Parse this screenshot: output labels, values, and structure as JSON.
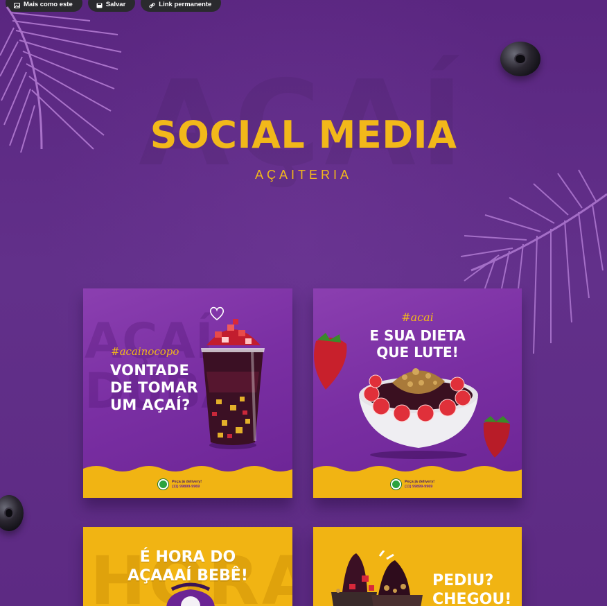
{
  "toolbar": {
    "more_like_this": "Mais como este",
    "save": "Salvar",
    "permalink": "Link permanente"
  },
  "header": {
    "title": "SOCIAL MEDIA",
    "subtitle": "AÇAITERIA"
  },
  "colors": {
    "background": "#5e2a82",
    "accent_yellow": "#f2b81a",
    "card_purple": "#7a2fa3",
    "whatsapp_green": "#2aa33f"
  },
  "cards": [
    {
      "hashtag": "#acainocopo",
      "headline_lines": [
        "VONTADE",
        "DE TOMAR",
        "UM AÇAÍ?"
      ],
      "delivery_label": "Peça já delivery!",
      "phone": "(11) 99899-9969",
      "image": "acai-cup-with-strawberries"
    },
    {
      "hashtag": "#acai",
      "headline_lines": [
        "E SUA DIETA",
        "QUE LUTE!"
      ],
      "delivery_label": "Peça já delivery!",
      "phone": "(11) 99899-9969",
      "image": "acai-bowl-with-strawberries-granola"
    },
    {
      "headline_lines": [
        "É HORA DO",
        "AÇAAAÍ BEBÊ!"
      ],
      "image": "alarm-clock"
    },
    {
      "headline_lines": [
        "PEDIU?",
        "CHEGOU!"
      ],
      "image": "acai-cups-with-toppings"
    }
  ]
}
